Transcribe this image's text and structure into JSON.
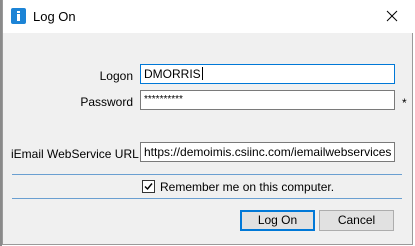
{
  "window": {
    "title": "Log On",
    "icon": "info-icon",
    "close_icon": "close-icon"
  },
  "form": {
    "logon_label": "Logon",
    "logon_value": "DMORRIS",
    "password_label": "Password",
    "password_value": "**********",
    "password_required_marker": "*",
    "service_url_label": "iEmail WebService URL",
    "service_url_value": "https://demoimis.csiinc.com/iemailwebservices",
    "remember_label": "Remember me on this computer.",
    "remember_checked": true
  },
  "buttons": {
    "logon": "Log On",
    "cancel": "Cancel"
  },
  "colors": {
    "accent": "#0078d7",
    "separator": "#6a9fd1",
    "dialog_bg": "#f0f0f0",
    "icon_blue": "#1c84d6"
  }
}
